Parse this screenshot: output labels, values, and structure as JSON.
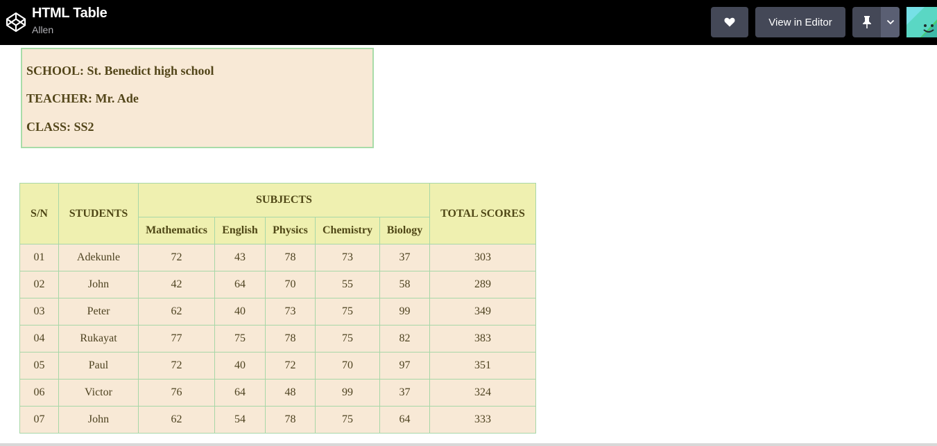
{
  "header": {
    "title": "HTML Table",
    "author": "Allen",
    "view_in_editor_label": "View in Editor",
    "icons": [
      "codepen-logo-icon",
      "heart-icon",
      "pin-icon",
      "chevron-down-icon"
    ]
  },
  "info": {
    "school": "SCHOOL: St. Benedict high school",
    "teacher": "TEACHER: Mr. Ade",
    "class": "CLASS: SS2"
  },
  "table": {
    "headers": {
      "sn": "S/N",
      "students": "STUDENTS",
      "subjects": "SUBJECTS",
      "total": "TOTAL SCORES",
      "subject_list": [
        "Mathematics",
        "English",
        "Physics",
        "Chemistry",
        "Biology"
      ]
    },
    "rows": [
      [
        "01",
        "Adekunle",
        "72",
        "43",
        "78",
        "73",
        "37",
        "303"
      ],
      [
        "02",
        "John",
        "42",
        "64",
        "70",
        "55",
        "58",
        "289"
      ],
      [
        "03",
        "Peter",
        "62",
        "40",
        "73",
        "75",
        "99",
        "349"
      ],
      [
        "04",
        "Rukayat",
        "77",
        "75",
        "78",
        "75",
        "82",
        "383"
      ],
      [
        "05",
        "Paul",
        "72",
        "40",
        "72",
        "70",
        "97",
        "351"
      ],
      [
        "06",
        "Victor",
        "76",
        "64",
        "48",
        "99",
        "37",
        "324"
      ],
      [
        "07",
        "John",
        "62",
        "54",
        "78",
        "75",
        "64",
        "333"
      ]
    ]
  },
  "colors": {
    "topbar": "#000000",
    "button_bg": "#444857",
    "cell_bg": "#f8e9d6",
    "header_bg": "#eff0b0",
    "border": "#a7d7a7"
  }
}
